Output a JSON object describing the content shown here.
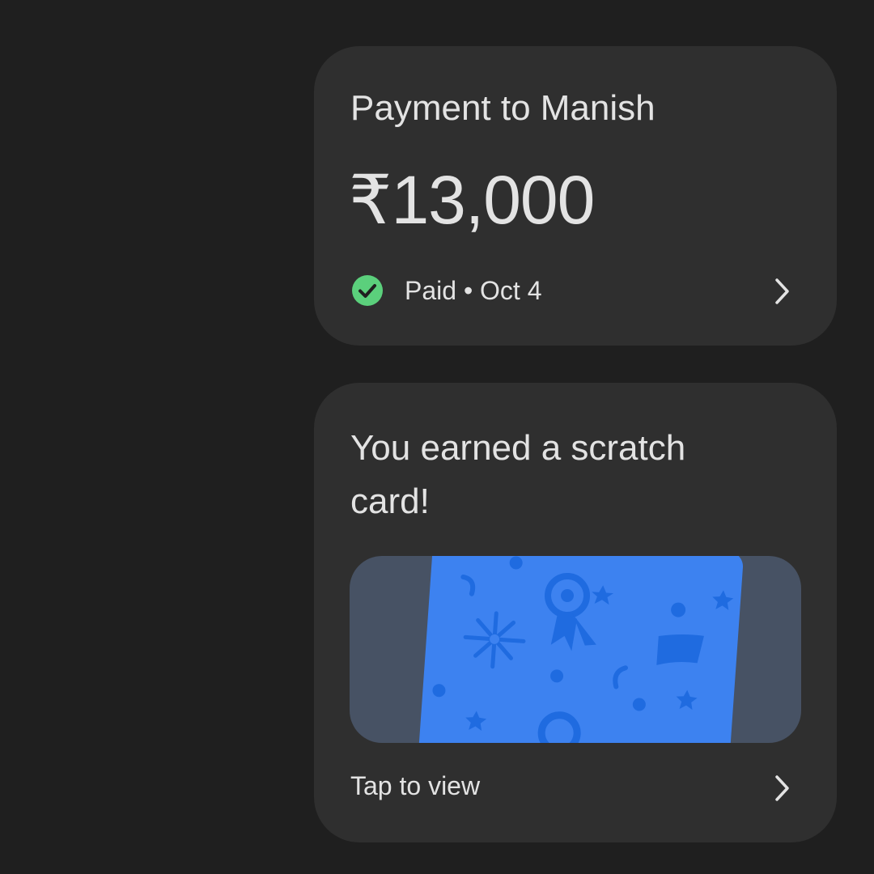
{
  "payment": {
    "title": "Payment to Manish",
    "amount": "₹13,000",
    "status": "Paid • Oct 4",
    "status_color": "#5bd07c"
  },
  "reward": {
    "title": "You earned a scratch card!",
    "action": "Tap to view",
    "card_color": "#3d82f0",
    "backdrop_color": "#475264"
  },
  "icons": {
    "status": "check-circle-icon",
    "open": "chevron-right-icon"
  }
}
